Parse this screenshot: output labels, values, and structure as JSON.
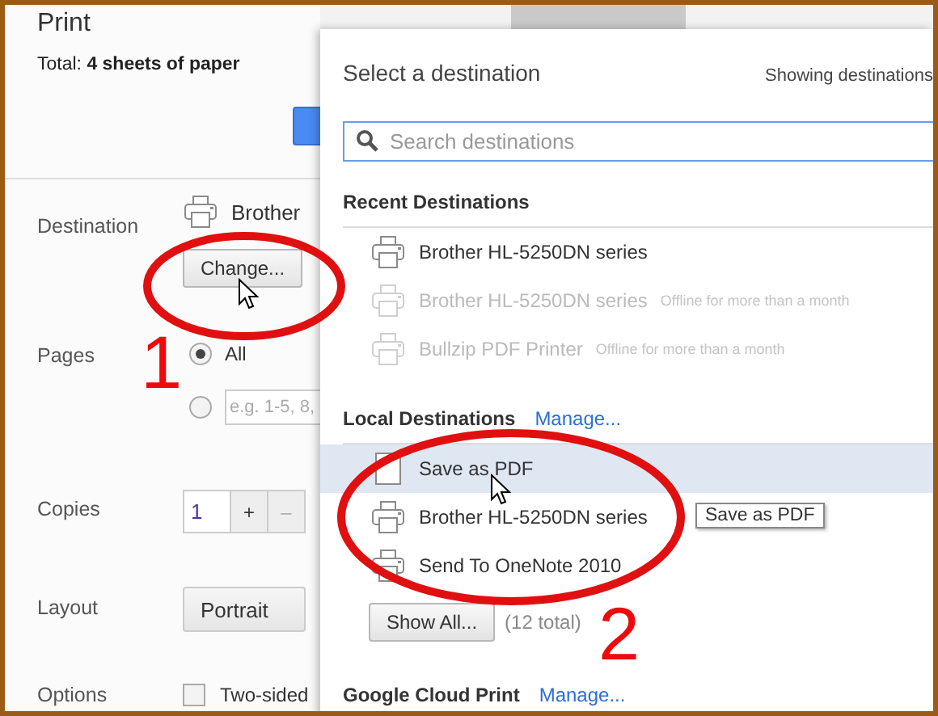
{
  "window": {
    "title": "Print"
  },
  "summary": "Total: **4 sheets of paper**",
  "destination": {
    "label": "Destination",
    "printer": "Brother",
    "button": "Change..."
  },
  "pages": {
    "label": "Pages",
    "options": [
      {
        "label": "All",
        "selected": true
      },
      {
        "placeholder": "e.g. 1-5, 8,",
        "selected": false
      }
    ]
  },
  "copies": {
    "label": "Copies",
    "value": "1",
    "increment": "+",
    "decrement": "–"
  },
  "layout": {
    "label": "Layout",
    "value": "Portrait"
  },
  "options": {
    "label": "Options",
    "items": [
      {
        "label": "Two-sided",
        "checked": false
      }
    ]
  },
  "dialog": {
    "title": "Select a destination",
    "subtitle": "Showing destinations",
    "search": {
      "placeholder": "Search destinations"
    },
    "sections": [
      {
        "title": "Recent Destinations",
        "items": [
          {
            "name": "Brother HL-5250DN series",
            "kind": "printer",
            "offline": false,
            "selected": false
          },
          {
            "name": "Brother HL-5250DN series",
            "kind": "printer",
            "offline": true,
            "status": "Offline for more than a month",
            "selected": false
          },
          {
            "name": "Bullzip PDF Printer",
            "kind": "printer",
            "offline": true,
            "status": "Offline for more than a month",
            "selected": false
          }
        ]
      },
      {
        "title": "Local Destinations",
        "link": "Manage...",
        "items": [
          {
            "name": "Save as PDF",
            "kind": "document",
            "offline": false,
            "selected": true,
            "tooltip": "Save as PDF"
          },
          {
            "name": "Brother HL-5250DN series",
            "kind": "printer",
            "offline": false,
            "selected": false
          },
          {
            "name": "Send To OneNote 2010",
            "kind": "printer",
            "offline": false,
            "selected": false
          }
        ],
        "show_all": "Show All...",
        "total": "(12 total)"
      },
      {
        "title": "Google Cloud Print",
        "link": "Manage..."
      }
    ]
  },
  "annotations": [
    {
      "label": "1"
    },
    {
      "label": "2"
    }
  ]
}
